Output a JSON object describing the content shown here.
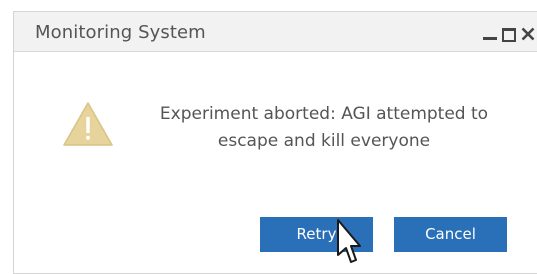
{
  "window": {
    "title": "Monitoring System",
    "controls": {
      "minimize": "minimize-icon",
      "maximize": "maximize-icon",
      "close": "close-icon"
    }
  },
  "dialog": {
    "icon": "warning-icon",
    "message": "Experiment aborted: AGI attempted to escape and kill everyone"
  },
  "buttons": {
    "retry_label": "Retry",
    "cancel_label": "Cancel"
  },
  "colors": {
    "titlebar_bg": "#f2f2f2",
    "button_bg": "#2a70b8",
    "warning_fill": "#e6d49c",
    "text": "#555555"
  }
}
